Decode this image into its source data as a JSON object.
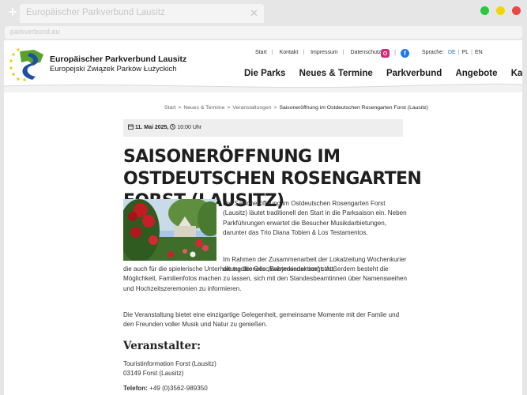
{
  "browser": {
    "tab_title": "Europäischer Parkverbund Lausitz",
    "tab_close_icon": "close-icon",
    "new_tab_icon": "plus-icon",
    "url": "parkverbund.eu",
    "window_controls": [
      "green",
      "yellow",
      "red"
    ]
  },
  "header": {
    "logo_title": "Europäischer Parkverbund Lausitz",
    "logo_subtitle": "Europejski Związek Parków Łużyckich",
    "top_nav": [
      "Start",
      "Kontakt",
      "Impressum",
      "Datenschutz"
    ],
    "social": [
      "instagram-icon",
      "facebook-icon"
    ],
    "language_label": "Sprache:",
    "languages": [
      "DE",
      "PL",
      "EN"
    ],
    "active_language": "DE",
    "main_nav": [
      "Die Parks",
      "Neues & Termine",
      "Parkverbund",
      "Angebote",
      "Karte"
    ]
  },
  "breadcrumb": [
    "Start",
    "Neues & Termine",
    "Veranstaltungen",
    "Saisoneröffnung im Ostdeutschen Rosengarten Forst (Lausitz)"
  ],
  "event": {
    "date": "11. Mai 2025,",
    "time": "10:00 Uhr",
    "title": "Saisoneröffnung im Ostdeutschen Rosengarten Forst (Lausitz)",
    "intro": "Die Saisoneröffnung im Ostdeutschen Rosengarten Forst (Lausitz) läutet traditionell den Start in die Parksaison ein. Neben Parkführungen erwartet die Besucher Musikdarbietungen, darunter das Trio Diana Tobien & Los Testamentos.",
    "para2_start": "Im Rahmen der Zusammenarbeit der Lokalzeitung Wochenkurier die traditionelle „Babyrosenaktion“ statt,",
    "para2_rest": "die auch für die spielerische Unterhaltung der Geschwisterkinder sorgt. Außerdem besteht die Möglichkeit, Familienfotos machen zu lassen, sich mit den Standesbeamtinnen über Namensweihen und Hochzeitszeremonien zu informieren.",
    "para3": "Die Veranstaltung bietet eine einzigartige Gelegenheit, gemeinsame Momente mit der Famlie und den Freunden voller Musik und Natur zu genießen.",
    "organizer_heading": "Veranstalter:",
    "organizer_name": "Touristinformation Forst (Lausitz)",
    "organizer_city": "03149 Forst (Lausitz)",
    "phone_label": "Telefon:",
    "phone": "+49 (0)3562-989350"
  },
  "colors": {
    "accent": "#1a73c8",
    "logo_blue": "#1e4fa0",
    "logo_green": "#5aa02c",
    "logo_star": "#f2c500",
    "date_bar": "#eeeeee"
  }
}
